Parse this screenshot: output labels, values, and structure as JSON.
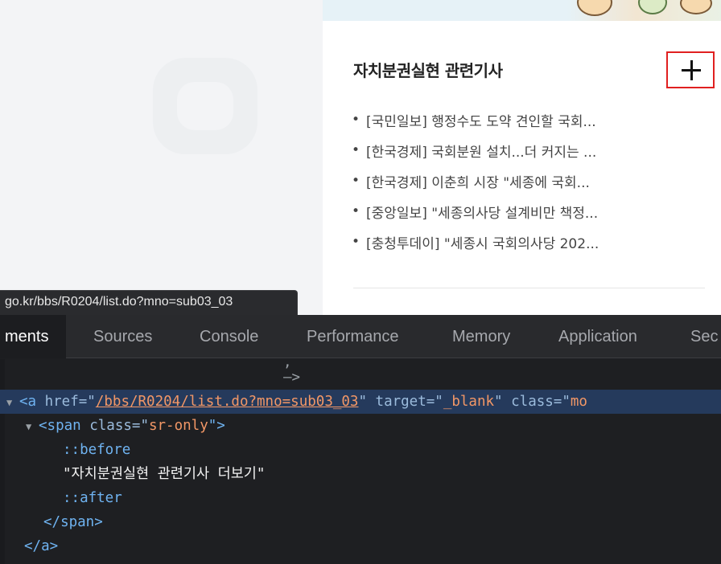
{
  "news_panel": {
    "title": "자치분권실현 관련기사",
    "more_button_sr_label": "자치분권실현 관련기사 더보기",
    "bullet": "•",
    "items": [
      {
        "text": "[국민일보] 행정수도 도약 견인할 국회..."
      },
      {
        "text": "[한국경제] 국회분원 설치...더 커지는 ..."
      },
      {
        "text": "[한국경제] 이춘희 시장 \"세종에 국회..."
      },
      {
        "text": "[중앙일보] \"세종의사당 설계비만 책정..."
      },
      {
        "text": "[충청투데이] \"세종시 국회의사당 202..."
      }
    ]
  },
  "status_bar": {
    "url": "go.kr/bbs/R0204/list.do?mno=sub03_03"
  },
  "devtools": {
    "tabs": [
      {
        "label": "ments"
      },
      {
        "label": "Sources"
      },
      {
        "label": "Console"
      },
      {
        "label": "Performance"
      },
      {
        "label": "Memory"
      },
      {
        "label": "Application"
      },
      {
        "label": "Sec"
      }
    ],
    "active_tab": "ments",
    "code": {
      "comment_end": "—>",
      "a_open": "<a",
      "href_attr": " href=\"",
      "href_val": "/bbs/R0204/list.do?mno=sub03_03",
      "target_attr": "\" target=\"",
      "target_val": "_blank",
      "class_attr": "\" class=\"",
      "class_val": "mo",
      "span_open_tag": "<span",
      "span_class_attr": " class=\"",
      "span_class_val": "sr-only",
      "span_open_close": "\">",
      "before": "::before",
      "text_node": "\"자치분권실현 관련기사 더보기\"",
      "after": "::after",
      "span_close": "</span>",
      "a_close": "</a>"
    }
  },
  "colors": {
    "highlight_border": "#e02020",
    "devtools_bg": "#1e1f22",
    "selected_line": "#253a5c",
    "tag": "#6fb3f1",
    "attr_value": "#f29766"
  }
}
